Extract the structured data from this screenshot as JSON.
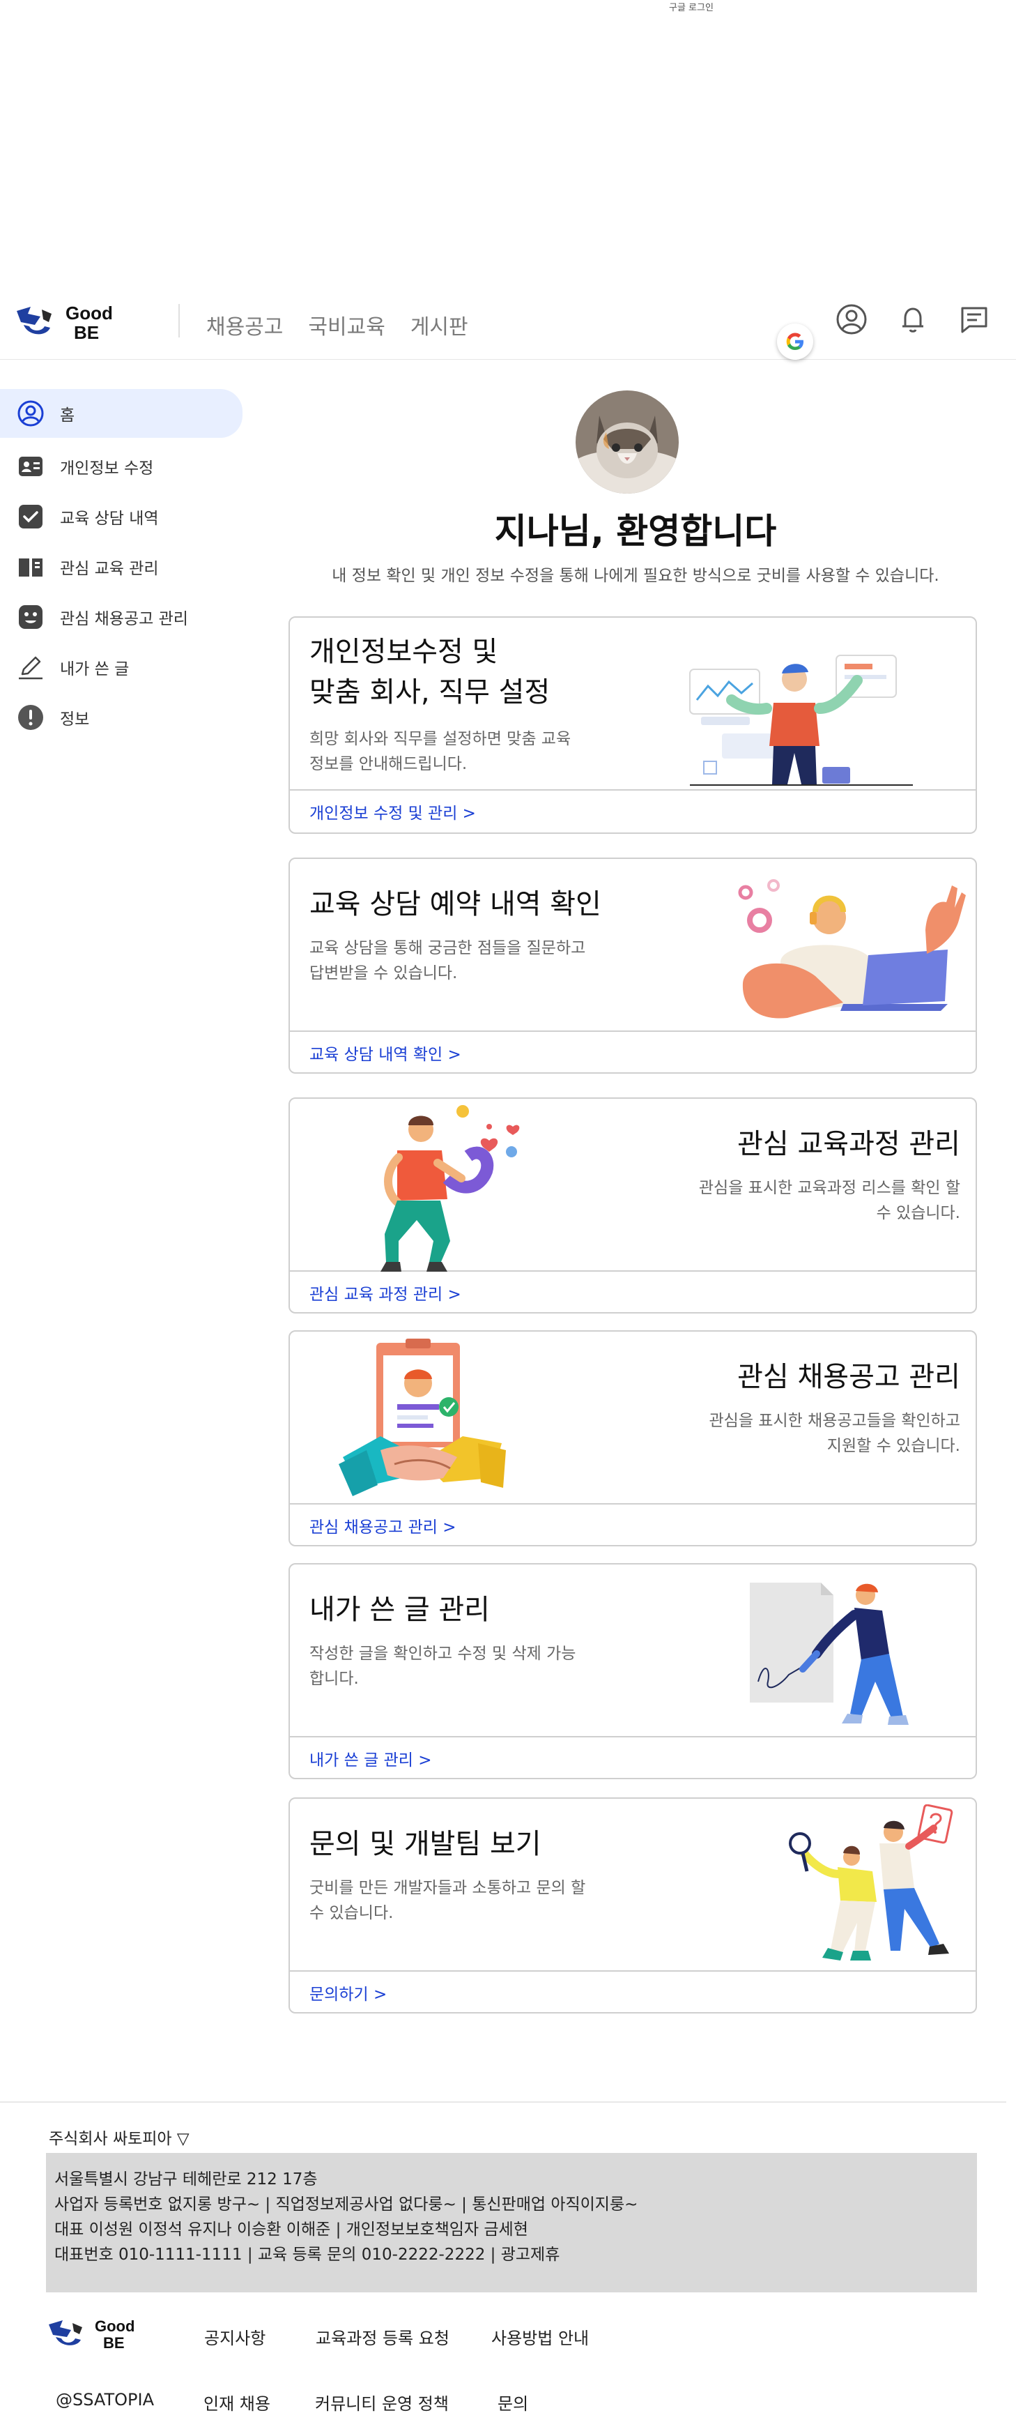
{
  "top": {
    "google_login": "구글 로그인"
  },
  "header": {
    "logo_text_line1": "Good",
    "logo_text_line2": "BE",
    "nav": [
      "채용공고",
      "국비교육",
      "게시판"
    ]
  },
  "sidebar": {
    "items": [
      {
        "label": "홈",
        "icon": "user-circle-icon",
        "active": true
      },
      {
        "label": "개인정보 수정",
        "icon": "id-card-icon",
        "active": false
      },
      {
        "label": "교육 상담 내역",
        "icon": "check-box-icon",
        "active": false
      },
      {
        "label": "관심 교육 관리",
        "icon": "book-open-icon",
        "active": false
      },
      {
        "label": "관심 채용공고 관리",
        "icon": "smile-face-icon",
        "active": false
      },
      {
        "label": "내가 쓴 글",
        "icon": "pencil-icon",
        "active": false
      },
      {
        "label": "정보",
        "icon": "info-icon",
        "active": false
      }
    ]
  },
  "main": {
    "welcome": "지나님, 환영합니다",
    "subtitle": "내 정보 확인 및 개인 정보 수정을 통해 나에게 필요한 방식으로 굿비를 사용할 수 있습니다.",
    "cards": [
      {
        "title_line1": "개인정보수정 및",
        "title_line2": "맞춤 회사, 직무 설정",
        "desc_line1": "희망 회사와 직무를 설정하면 맞춤 교육",
        "desc_line2": "정보를 안내해드립니다.",
        "link": "개인정보 수정 및 관리 >"
      },
      {
        "title_line1": "교육 상담 예약 내역 확인",
        "desc_line1": "교육 상담을 통해 궁금한 점들을 질문하고",
        "desc_line2": "답변받을 수 있습니다.",
        "link": "교육 상담 내역 확인 >"
      },
      {
        "title_line1": "관심 교육과정 관리",
        "desc_line1": "관심을 표시한 교육과정 리스를 확인 할",
        "desc_line2": "수 있습니다.",
        "link": "관심 교육 과정 관리 >"
      },
      {
        "title_line1": "관심 채용공고 관리",
        "desc_line1": "관심을 표시한 채용공고들을 확인하고",
        "desc_line2": "지원할 수 있습니다.",
        "link": "관심 채용공고 관리 >"
      },
      {
        "title_line1": "내가 쓴 글 관리",
        "desc_line1": "작성한 글을 확인하고 수정 및 삭제 가능",
        "desc_line2": "합니다.",
        "link": "내가 쓴 글 관리 >"
      },
      {
        "title_line1": "문의 및 개발팀 보기",
        "desc_line1": "굿비를 만든 개발자들과 소통하고 문의 할",
        "desc_line2": "수 있습니다.",
        "link": "문의하기 >"
      }
    ]
  },
  "footer": {
    "company": "주식회사 싸토피아 ▽",
    "info": [
      "서울특별시 강남구 테헤란로 212 17층",
      "사업자 등록번호  없지롱 방구~ | 직업정보제공사업 없다룽~ | 통신판매업 아직이지룽~",
      "대표 이성원 이정석 유지나 이승환 이해준 | 개인정보보호책임자 금세현",
      "대표번호 010-1111-1111 | 교육 등록 문의 010-2222-2222 | 광고제휴"
    ],
    "links_row1": [
      "공지사항",
      "교육과정 등록 요청",
      "사용방법 안내"
    ],
    "links_row2": [
      "@SSATOPIA",
      "인재 채용",
      "커뮤니티 운영 정책",
      "문의"
    ]
  },
  "colors": {
    "accent": "#1a3fd4",
    "logo_blue": "#1f3fa0",
    "active_bg": "#e8efff"
  }
}
